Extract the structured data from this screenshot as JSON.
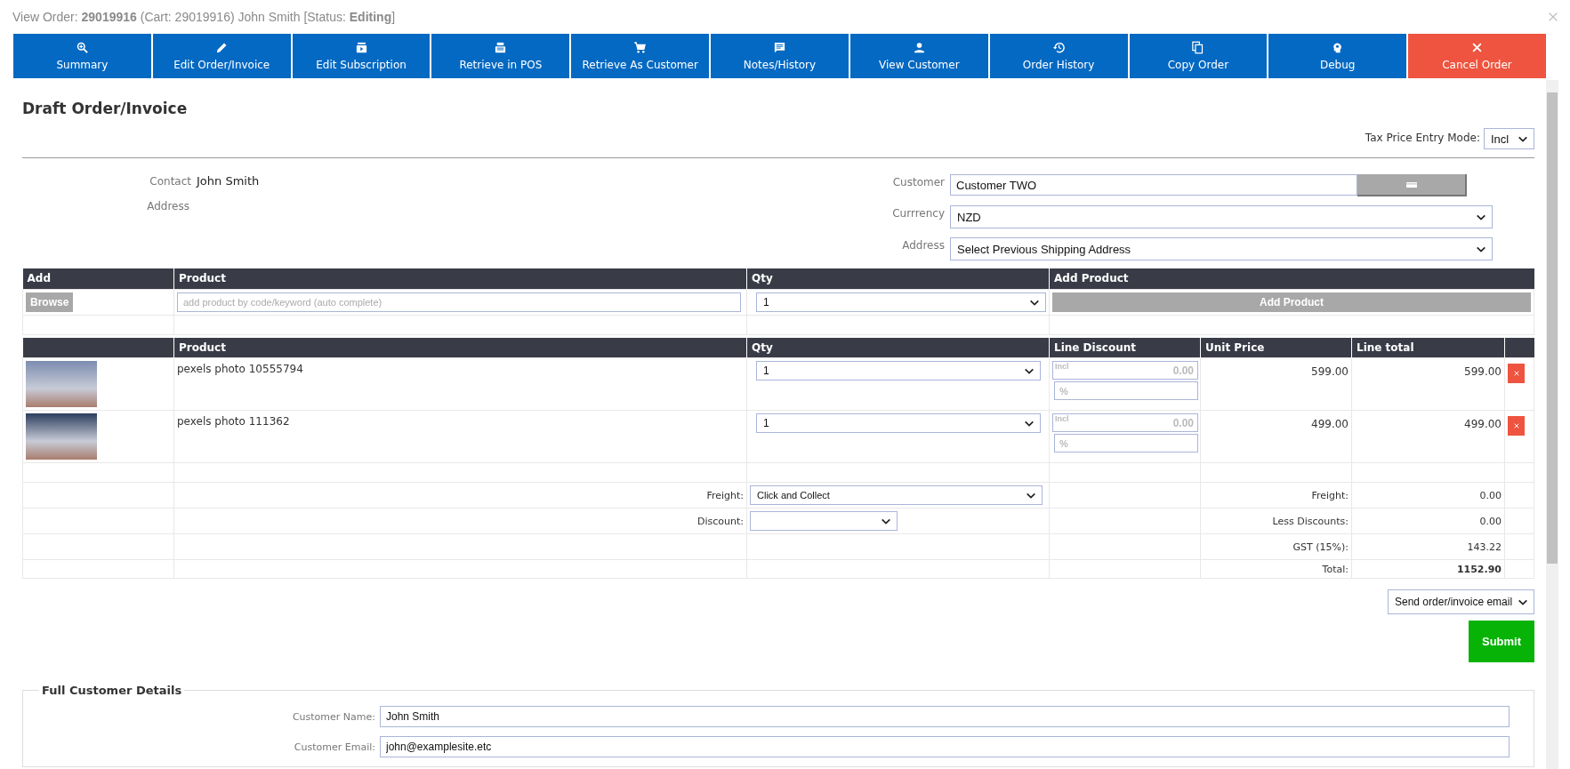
{
  "window": {
    "title": "View Order: **29019916** (Cart: 29019916) John Smith [Status: **Editing**]"
  },
  "toolbar": [
    {
      "label": "Summary",
      "kind": "action"
    },
    {
      "label": "Edit Order/Invoice",
      "kind": "action"
    },
    {
      "label": "Edit Subscription",
      "kind": "action"
    },
    {
      "label": "Retrieve in POS",
      "kind": "action"
    },
    {
      "label": "Retrieve As Customer",
      "kind": "action"
    },
    {
      "label": "Notes/History",
      "kind": "action"
    },
    {
      "label": "View Customer",
      "kind": "action"
    },
    {
      "label": "Order History",
      "kind": "action"
    },
    {
      "label": "Copy Order",
      "kind": "action"
    },
    {
      "label": "Debug",
      "kind": "action"
    },
    {
      "label": "Cancel Order",
      "kind": "danger"
    }
  ],
  "heading": "Draft Order/Invoice",
  "tax_mode": {
    "label": "Tax Price Entry Mode:",
    "value": "Incl"
  },
  "contact": {
    "label": "Contact",
    "value": "John Smith"
  },
  "address_label": "Address",
  "customer": {
    "label": "Customer",
    "value": "Customer TWO"
  },
  "currency": {
    "label": "Currrency",
    "value": "NZD"
  },
  "shipping_address": {
    "label": "Address",
    "value": "Select Previous Shipping Address"
  },
  "add_table": {
    "columns": [
      "Add",
      "Product",
      "Qty",
      "Add Product"
    ],
    "browse": "Browse",
    "product_placeholder": "add product by code/keyword (auto complete)",
    "qty": "1",
    "add_button": "Add Product"
  },
  "lines_table": {
    "columns": [
      "Product",
      "Qty",
      "Line Discount",
      "Unit Price",
      "Line total"
    ],
    "rows": [
      {
        "product": "pexels photo 10555794",
        "qty": "1",
        "discount_mode": "Incl",
        "discount_value": "0.00",
        "percent_placeholder": "%",
        "unit_price": "599.00",
        "line_total": "599.00"
      },
      {
        "product": "pexels photo 111362",
        "qty": "1",
        "discount_mode": "Incl",
        "discount_value": "0.00",
        "percent_placeholder": "%",
        "unit_price": "499.00",
        "line_total": "499.00"
      }
    ]
  },
  "freight_select": {
    "label": "Freight:",
    "value": "Click and Collect"
  },
  "discount_select": {
    "label": "Discount:"
  },
  "summary": [
    {
      "label": "Freight:",
      "value": "0.00",
      "kind": "amount"
    },
    {
      "label": "Less Discounts:",
      "value": "0.00",
      "kind": "amount"
    },
    {
      "label": "GST (15%):",
      "value": "143.22",
      "kind": "amount"
    },
    {
      "label": "Total:",
      "value": "1152.90",
      "kind": "total"
    }
  ],
  "email_action": "Send order/invoice email",
  "submit": "Submit",
  "customer_details": {
    "legend": "Full Customer Details",
    "fields": [
      {
        "label": "Customer Name:",
        "value": "John Smith"
      },
      {
        "label": "Customer Email:",
        "value": "john@examplesite.etc"
      }
    ]
  }
}
